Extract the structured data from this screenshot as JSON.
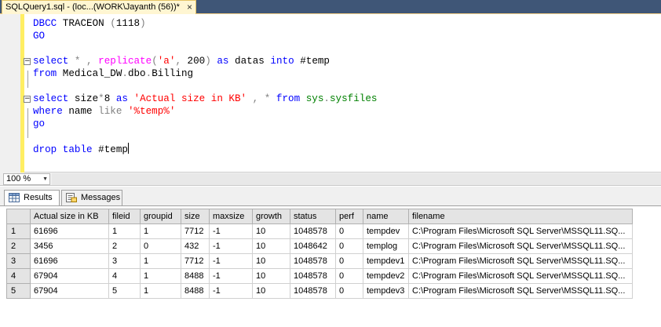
{
  "document_tab": {
    "title": "SQLQuery1.sql - (loc...(WORK\\Jayanth (56))*",
    "close_glyph": "×"
  },
  "editor": {
    "lines": [
      [
        {
          "t": "DBCC ",
          "c": "kw"
        },
        {
          "t": "TRACEON ",
          "c": "plain"
        },
        {
          "t": "(",
          "c": "op"
        },
        {
          "t": "1118",
          "c": "plain"
        },
        {
          "t": ")",
          "c": "op"
        }
      ],
      [
        {
          "t": "GO",
          "c": "kw"
        }
      ],
      [],
      [
        {
          "t": "select ",
          "c": "kw"
        },
        {
          "t": "*",
          "c": "op"
        },
        {
          "t": " ",
          "c": "plain"
        },
        {
          "t": ",",
          "c": "op"
        },
        {
          "t": " ",
          "c": "plain"
        },
        {
          "t": "replicate",
          "c": "fn"
        },
        {
          "t": "(",
          "c": "op"
        },
        {
          "t": "'a'",
          "c": "str"
        },
        {
          "t": ",",
          "c": "op"
        },
        {
          "t": " 200",
          "c": "plain"
        },
        {
          "t": ")",
          "c": "op"
        },
        {
          "t": " ",
          "c": "plain"
        },
        {
          "t": "as ",
          "c": "kw"
        },
        {
          "t": "datas ",
          "c": "plain"
        },
        {
          "t": "into ",
          "c": "kw"
        },
        {
          "t": "#temp",
          "c": "plain"
        }
      ],
      [
        {
          "t": "from ",
          "c": "kw"
        },
        {
          "t": "Medical_DW",
          "c": "plain"
        },
        {
          "t": ".",
          "c": "op"
        },
        {
          "t": "dbo",
          "c": "plain"
        },
        {
          "t": ".",
          "c": "op"
        },
        {
          "t": "Billing",
          "c": "plain"
        }
      ],
      [],
      [
        {
          "t": "select ",
          "c": "kw"
        },
        {
          "t": "size",
          "c": "plain"
        },
        {
          "t": "*",
          "c": "op"
        },
        {
          "t": "8 ",
          "c": "plain"
        },
        {
          "t": "as ",
          "c": "kw"
        },
        {
          "t": "'Actual size in KB'",
          "c": "str"
        },
        {
          "t": " ",
          "c": "plain"
        },
        {
          "t": ",",
          "c": "op"
        },
        {
          "t": " ",
          "c": "plain"
        },
        {
          "t": "*",
          "c": "op"
        },
        {
          "t": " ",
          "c": "plain"
        },
        {
          "t": "from ",
          "c": "kw"
        },
        {
          "t": "sys",
          "c": "sys"
        },
        {
          "t": ".",
          "c": "op"
        },
        {
          "t": "sysfiles",
          "c": "sys"
        }
      ],
      [
        {
          "t": "where ",
          "c": "kw"
        },
        {
          "t": "name ",
          "c": "plain"
        },
        {
          "t": "like ",
          "c": "op"
        },
        {
          "t": "'%temp%'",
          "c": "str"
        }
      ],
      [
        {
          "t": "go",
          "c": "kw"
        }
      ],
      [],
      [
        {
          "t": "drop ",
          "c": "kw"
        },
        {
          "t": "table ",
          "c": "kw"
        },
        {
          "t": "#temp",
          "c": "plain"
        }
      ]
    ],
    "fold_lines": [
      3,
      6
    ]
  },
  "zoom": {
    "value": "100 %"
  },
  "result_tabs": [
    {
      "label": "Results",
      "active": true
    },
    {
      "label": "Messages",
      "active": false
    }
  ],
  "grid": {
    "columns": [
      "Actual size in KB",
      "fileid",
      "groupid",
      "size",
      "maxsize",
      "growth",
      "status",
      "perf",
      "name",
      "filename"
    ],
    "rows": [
      [
        "1",
        "61696",
        "1",
        "1",
        "7712",
        "-1",
        "10",
        "1048578",
        "0",
        "tempdev",
        "C:\\Program Files\\Microsoft SQL Server\\MSSQL11.SQ..."
      ],
      [
        "2",
        "3456",
        "2",
        "0",
        "432",
        "-1",
        "10",
        "1048642",
        "0",
        "templog",
        "C:\\Program Files\\Microsoft SQL Server\\MSSQL11.SQ..."
      ],
      [
        "3",
        "61696",
        "3",
        "1",
        "7712",
        "-1",
        "10",
        "1048578",
        "0",
        "tempdev1",
        "C:\\Program Files\\Microsoft SQL Server\\MSSQL11.SQ..."
      ],
      [
        "4",
        "67904",
        "4",
        "1",
        "8488",
        "-1",
        "10",
        "1048578",
        "0",
        "tempdev2",
        "C:\\Program Files\\Microsoft SQL Server\\MSSQL11.SQ..."
      ],
      [
        "5",
        "67904",
        "5",
        "1",
        "8488",
        "-1",
        "10",
        "1048578",
        "0",
        "tempdev3",
        "C:\\Program Files\\Microsoft SQL Server\\MSSQL11.SQ..."
      ]
    ]
  },
  "colors": {
    "tab_strip": "#3f5677",
    "active_tab": "#fff6d2",
    "keyword": "#0000ff",
    "function": "#ff00ff",
    "string": "#ff0000",
    "system_object": "#008000",
    "operator": "#808080",
    "change_bar": "#ffee62"
  },
  "icons": {
    "results_tab": "grid-icon",
    "messages_tab": "messages-icon",
    "zoom_dropdown": "chevron-down-icon"
  }
}
